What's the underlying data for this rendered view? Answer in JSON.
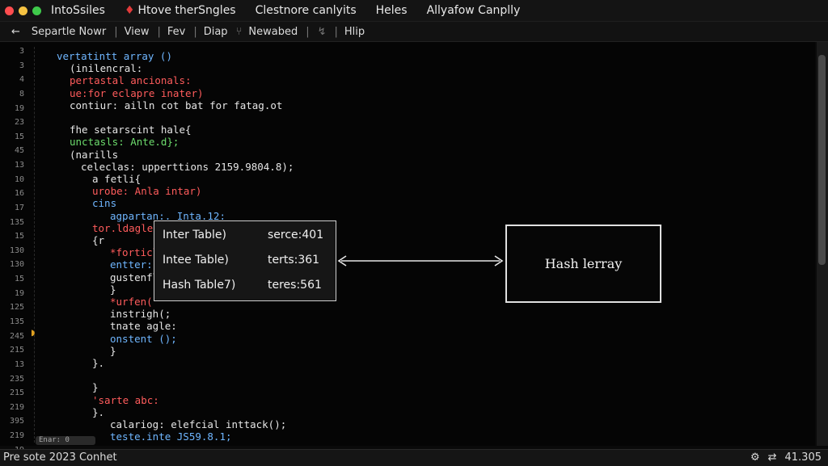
{
  "window": {
    "tabs": [
      {
        "label": "IntoSsiles",
        "marked": false
      },
      {
        "label": "Htove therSngles",
        "marked": true
      },
      {
        "label": "Clestnore canlyits",
        "marked": false
      },
      {
        "label": "Heles",
        "marked": false
      },
      {
        "label": "Allyafow Canplly",
        "marked": false
      }
    ],
    "traffic_lights": [
      "close",
      "minimize",
      "maximize"
    ]
  },
  "toolbar": {
    "back_icon": "←",
    "items": [
      "Separtle Nowr",
      "View",
      "Fev",
      "Diap",
      "Newabed",
      "Hlip"
    ],
    "icons": [
      "branch-icon",
      "arrow-icon"
    ]
  },
  "editor": {
    "line_numbers": [
      "3",
      "3",
      "4",
      "8",
      "19",
      "23",
      "15",
      "45",
      "13",
      "10",
      "16",
      "17",
      "135",
      "15",
      "130",
      "130",
      "15",
      "19",
      "125",
      "135",
      "245",
      "215",
      "13",
      "235",
      "215",
      "219",
      "395",
      "219",
      "19"
    ],
    "code_lines": [
      {
        "text": "vertatintt array ()",
        "color": "blue",
        "indent": 0
      },
      {
        "text": "(inilencral:",
        "color": "white",
        "indent": 1
      },
      {
        "text": "pertastal ancionals:",
        "color": "red",
        "indent": 1
      },
      {
        "text": "ue:for eclapre inater)",
        "color": "red",
        "indent": 1
      },
      {
        "text": "contiur: ailln cot bat for fatag.ot",
        "color": "white",
        "indent": 1
      },
      {
        "text": "",
        "color": "white",
        "indent": 0
      },
      {
        "text": "fhe setarscint hale{",
        "color": "white",
        "indent": 1
      },
      {
        "text": "unctasls: Ante.d};",
        "color": "green",
        "indent": 1
      },
      {
        "text": "(narills",
        "color": "white",
        "indent": 1
      },
      {
        "text": "celeclas: upperttions 2159.9804.8);",
        "color": "white",
        "indent": 2
      },
      {
        "text": "a fetli{",
        "color": "white",
        "indent": 3
      },
      {
        "text": "urobe: Anla intar)",
        "color": "red",
        "indent": 3
      },
      {
        "text": "cins",
        "color": "blue",
        "indent": 3
      },
      {
        "text": "agpartan:. Inta.12:",
        "color": "blue",
        "indent": 4
      },
      {
        "text": "tor.ldagle{f);",
        "color": "red",
        "indent": 3
      },
      {
        "text": "{r",
        "color": "white",
        "indent": 3
      },
      {
        "text": "*forticl",
        "color": "red",
        "indent": 4
      },
      {
        "text": "entter:",
        "color": "blue",
        "indent": 4
      },
      {
        "text": "gustenfl",
        "color": "white",
        "indent": 4
      },
      {
        "text": "}",
        "color": "white",
        "indent": 4
      },
      {
        "text": "*urfen(",
        "color": "red",
        "indent": 4
      },
      {
        "text": "instrigh(;",
        "color": "white",
        "indent": 4
      },
      {
        "text": "tnate agle:",
        "color": "white",
        "indent": 4
      },
      {
        "text": "onstent ();",
        "color": "blue",
        "indent": 4
      },
      {
        "text": "}",
        "color": "white",
        "indent": 4
      },
      {
        "text": "}.",
        "color": "white",
        "indent": 3
      },
      {
        "text": "",
        "color": "white",
        "indent": 0
      },
      {
        "text": "}",
        "color": "white",
        "indent": 3
      },
      {
        "text": "'sarte abc:",
        "color": "red",
        "indent": 3
      },
      {
        "text": "}.",
        "color": "white",
        "indent": 3
      },
      {
        "text": "calariog: elefcial inttack();",
        "color": "white",
        "indent": 4
      },
      {
        "text": "teste.inte JS59.8.1;",
        "color": "blue",
        "indent": 4
      }
    ],
    "h_scroll_label": "Enar: 0"
  },
  "hash_popup": {
    "rows": [
      {
        "name": "Inter Table)",
        "value": "serce:401"
      },
      {
        "name": "Intee Table)",
        "value": "terts:361"
      },
      {
        "name": "Hash Table7)",
        "value": "teres:561"
      }
    ]
  },
  "hash_box": {
    "label": "Hash lerray"
  },
  "status": {
    "left": "Pre sote 2023 Conhet",
    "right_text": "41.305",
    "icons": [
      "settings-icon",
      "sync-icon"
    ]
  },
  "colors": {
    "blue": "#6fb6ff",
    "red": "#ff5c5c",
    "green": "#6ddc6d",
    "white": "#e6e6e6"
  }
}
